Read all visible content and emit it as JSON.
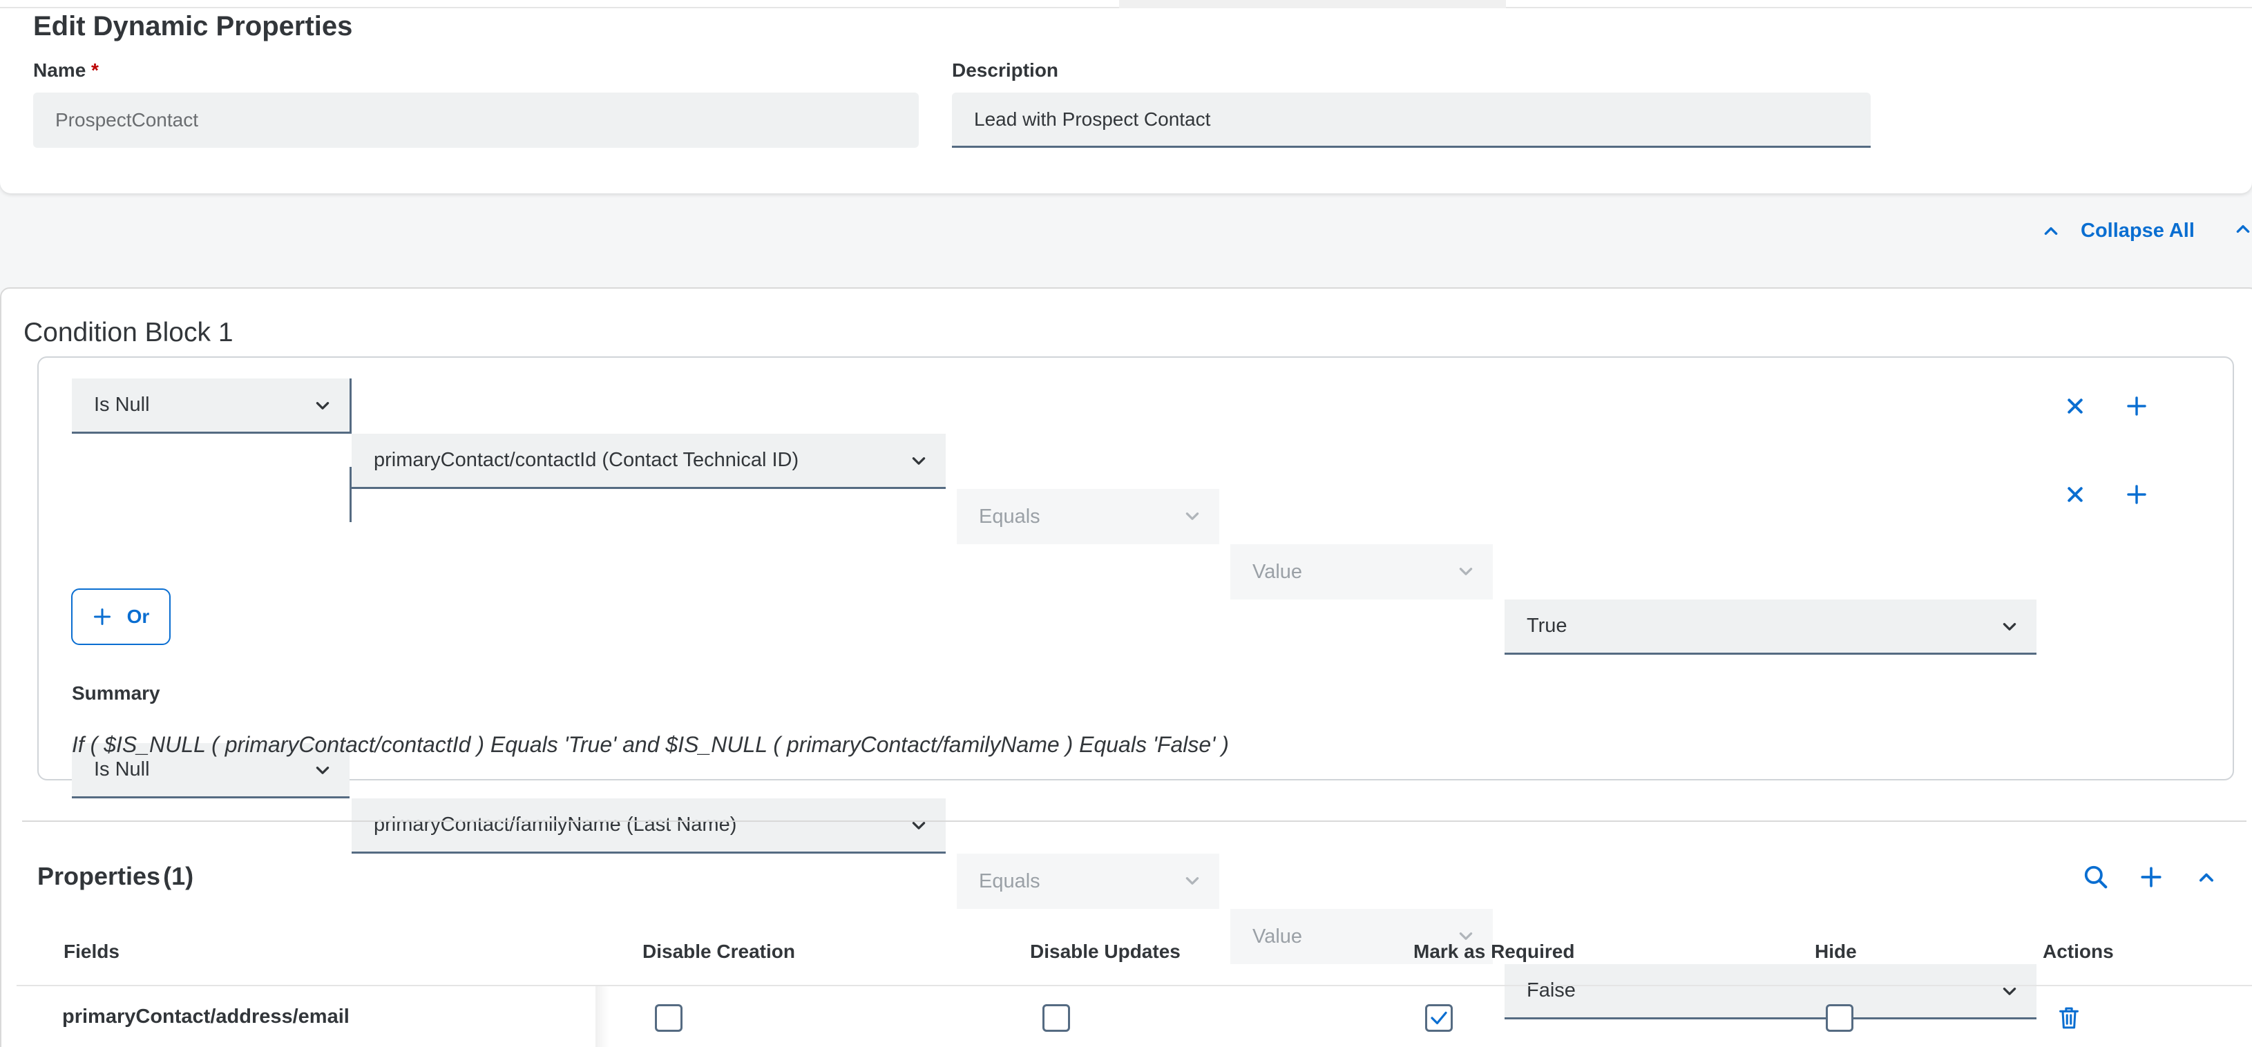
{
  "header": {
    "title": "Edit Dynamic Properties",
    "name_label": "Name",
    "required_mark": "*",
    "name_value": "ProspectContact",
    "description_label": "Description",
    "description_value": "Lead with Prospect Contact"
  },
  "toolbar": {
    "collapse_all_label": "Collapse All"
  },
  "condition_block": {
    "title": "Condition Block 1",
    "rows": [
      {
        "function": "Is Null",
        "field": "primaryContact/contactId (Contact Technical ID)",
        "operator": "Equals",
        "value_type": "Value",
        "value": "True"
      },
      {
        "function": "Is Null",
        "field": "primaryContact/familyName (Last Name)",
        "operator": "Equals",
        "value_type": "Value",
        "value": "False"
      }
    ],
    "or_label": "Or",
    "summary_label": "Summary",
    "summary_text": "If ( $IS_NULL ( primaryContact/contactId ) Equals 'True' and $IS_NULL ( primaryContact/familyName ) Equals 'False' )"
  },
  "properties": {
    "title": "Properties",
    "count": "(1)",
    "columns": [
      "Fields",
      "Disable Creation",
      "Disable Updates",
      "Mark as Required",
      "Hide",
      "Actions"
    ],
    "rows": [
      {
        "field": "primaryContact/address/email",
        "disable_creation": false,
        "disable_updates": false,
        "mark_as_required": true,
        "hide": false
      }
    ]
  },
  "colors": {
    "accent": "#0a6ed1",
    "text": "#32363a",
    "field_bg": "#eff1f2"
  }
}
